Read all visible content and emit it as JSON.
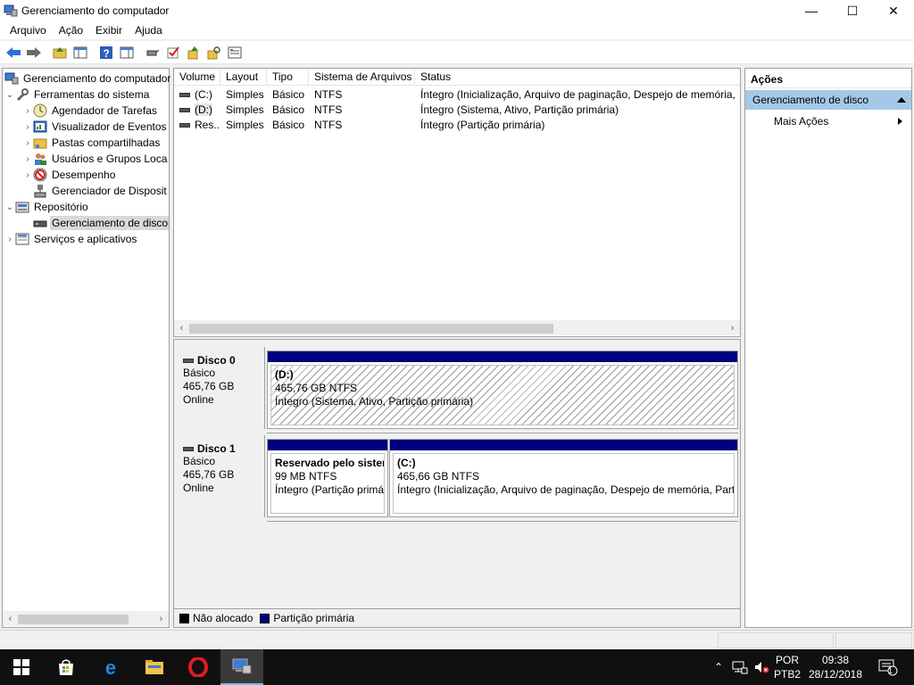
{
  "window": {
    "title": "Gerenciamento do computador",
    "controls": {
      "minimize": "—",
      "maximize": "☐",
      "close": "✕"
    }
  },
  "menu": [
    "Arquivo",
    "Ação",
    "Exibir",
    "Ajuda"
  ],
  "toolbar_icons": [
    "back-arrow-icon",
    "forward-arrow-icon",
    "up-folder-icon",
    "show-hide-tree-icon",
    "help-icon",
    "console-icon",
    "connect-icon",
    "check-icon",
    "export-icon",
    "find-icon",
    "properties-icon"
  ],
  "tree": {
    "root": "Gerenciamento do computador",
    "system_tools": "Ferramentas do sistema",
    "task_scheduler": "Agendador de Tarefas",
    "event_viewer": "Visualizador de Eventos",
    "shared_folders": "Pastas compartilhadas",
    "local_users": "Usuários e Grupos Loca",
    "performance": "Desempenho",
    "device_manager": "Gerenciador de Disposit",
    "storage": "Repositório",
    "disk_management": "Gerenciamento de disco",
    "services": "Serviços e aplicativos"
  },
  "volume_list": {
    "columns": [
      "Volume",
      "Layout",
      "Tipo",
      "Sistema de Arquivos",
      "Status"
    ],
    "rows": [
      [
        "(C:)",
        "Simples",
        "Básico",
        "NTFS",
        "Íntegro (Inicialização, Arquivo de paginação, Despejo de memória, P"
      ],
      [
        "(D:)",
        "Simples",
        "Básico",
        "NTFS",
        "Íntegro (Sistema, Ativo, Partição primária)"
      ],
      [
        "Res...",
        "Simples",
        "Básico",
        "NTFS",
        "Íntegro (Partição primária)"
      ]
    ]
  },
  "disks": {
    "disk0": {
      "name": "Disco 0",
      "type": "Básico",
      "size": "465,76 GB",
      "status": "Online",
      "partitions": [
        {
          "name": "(D:)",
          "size": "465,76 GB NTFS",
          "status": "Íntegro (Sistema, Ativo, Partição primária)"
        }
      ]
    },
    "disk1": {
      "name": "Disco 1",
      "type": "Básico",
      "size": "465,76 GB",
      "status": "Online",
      "partitions": [
        {
          "name": "Reservado pelo sisten",
          "size": "99 MB NTFS",
          "status": "Íntegro (Partição primá"
        },
        {
          "name": "(C:)",
          "size": "465,66 GB NTFS",
          "status": "Íntegro (Inicialização, Arquivo de paginação, Despejo de memória, Parti"
        }
      ]
    }
  },
  "legend": {
    "unallocated": "Não alocado",
    "primary": "Partição primária",
    "colors": {
      "unallocated": "#000000",
      "primary": "#000080"
    }
  },
  "actions": {
    "header": "Ações",
    "section": "Gerenciamento de disco",
    "more": "Mais Ações"
  },
  "taskbar": {
    "apps": [
      "start-icon",
      "store-icon",
      "edge-icon",
      "explorer-icon",
      "opera-icon",
      "computer-management-icon"
    ],
    "lang_top": "POR",
    "lang_bottom": "PTB2",
    "time": "09:38",
    "date": "28/12/2018",
    "notifications": "1"
  }
}
